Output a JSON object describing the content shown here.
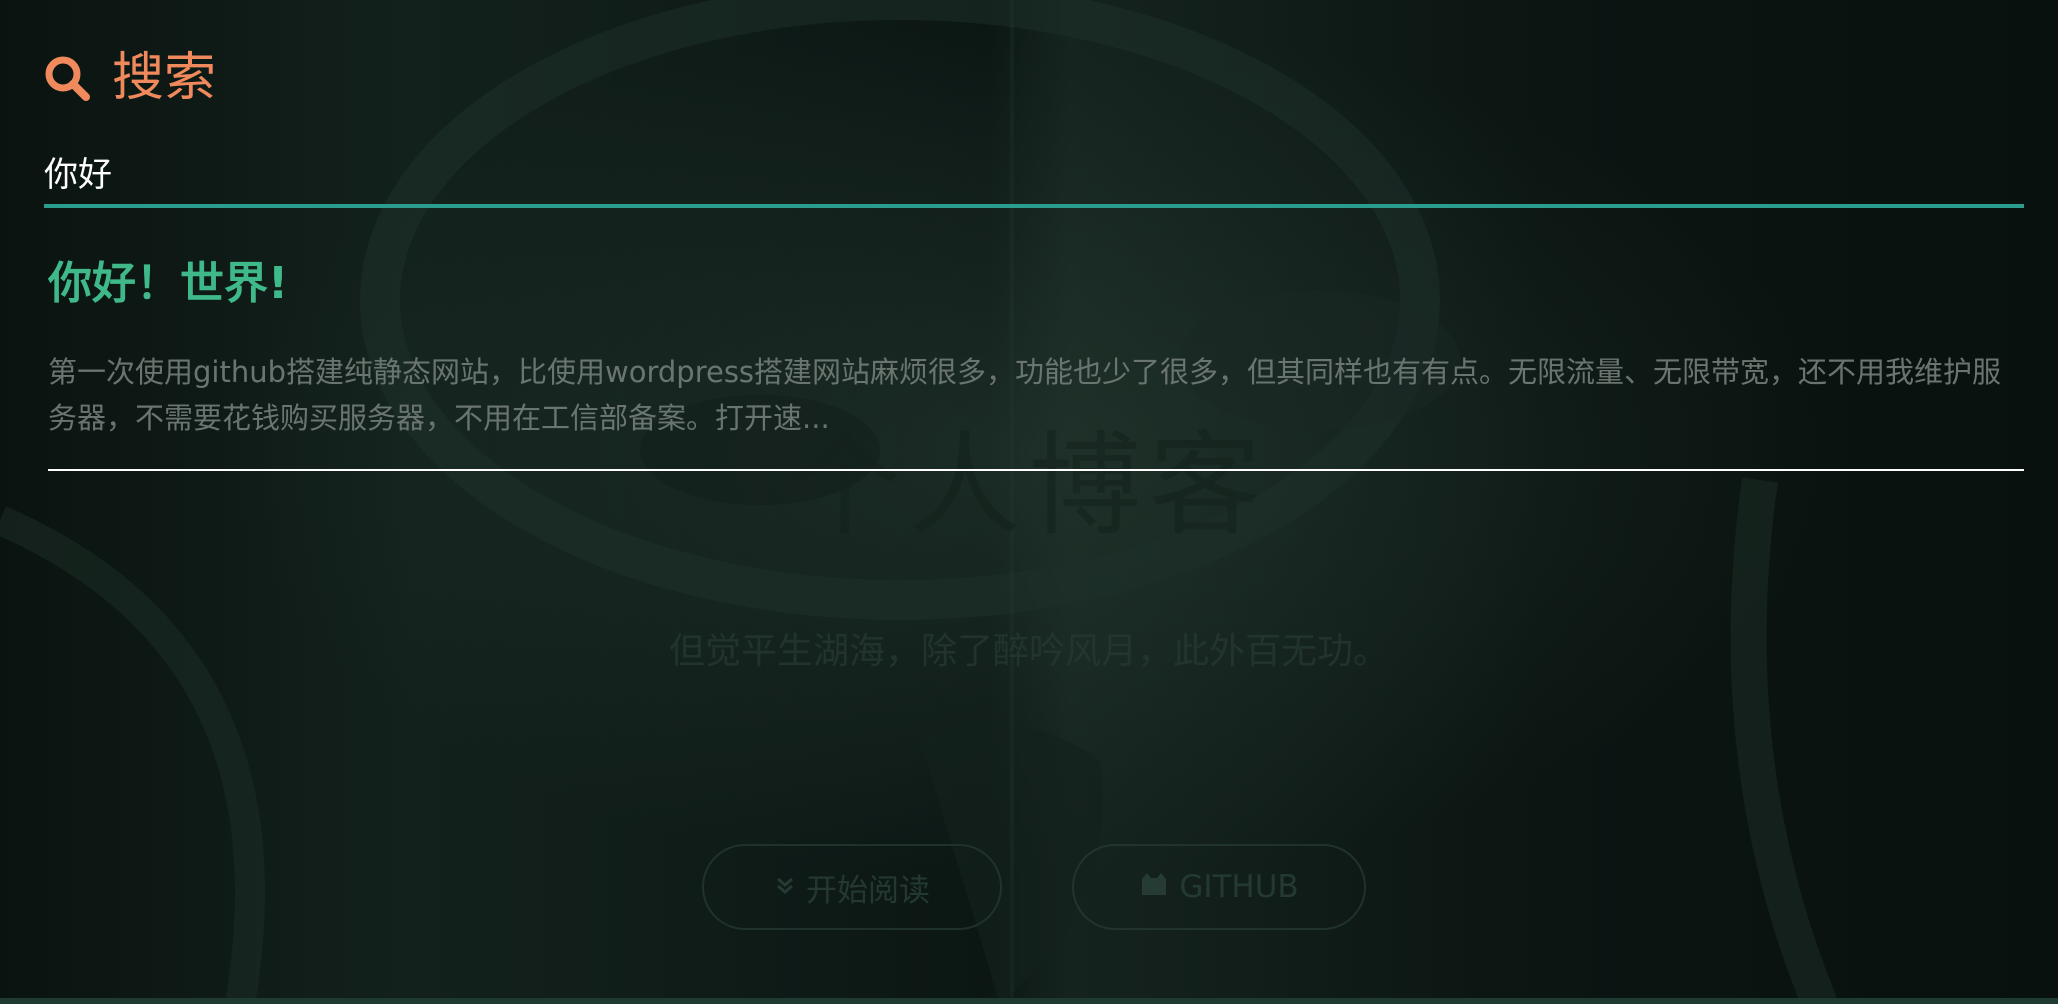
{
  "background": {
    "hero_title": "个人博客",
    "hero_subtitle": "但觉平生湖海，除了醉吟风月，此外百无功。",
    "buttons": {
      "read_label": "开始阅读",
      "github_label": "GITHUB"
    }
  },
  "search": {
    "title": "搜索",
    "query": "你好",
    "accent_color": "#f08a5d",
    "underline_color": "#2a9d8f"
  },
  "results": [
    {
      "title": "你好！世界!",
      "excerpt": "第一次使用github搭建纯静态网站，比使用wordpress搭建网站麻烦很多，功能也少了很多，但其同样也有有点。无限流量、无限带宽，还不用我维护服务器，不需要花钱购买服务器，不用在工信部备案。打开速..."
    }
  ],
  "icons": {
    "search": "search-icon",
    "chevron": "chevron-down-icon",
    "github": "github-icon"
  }
}
